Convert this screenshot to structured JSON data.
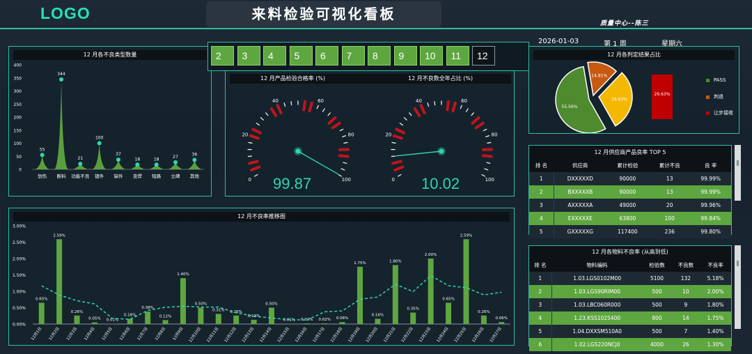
{
  "header": {
    "logo": "LOGO",
    "title": "来料检验可视化看板",
    "dept": "质量中心--陈三",
    "date": "2026-01-03",
    "week": "第 1 周",
    "weekday": "星期六"
  },
  "months": [
    "2",
    "3",
    "4",
    "5",
    "6",
    "7",
    "8",
    "9",
    "10",
    "11",
    "12"
  ],
  "selected_month": "12",
  "defect_types": {
    "title": "12 月各不良类型数量",
    "chart_data": {
      "type": "area",
      "categories": [
        "划伤",
        "断料",
        "功能不良",
        "镀件",
        "缺件",
        "变焊",
        "短路",
        "立碑",
        "其他"
      ],
      "values": [
        55,
        344,
        21,
        100,
        37,
        18,
        18,
        27,
        36
      ],
      "ylim": [
        0,
        400
      ],
      "yticks": [
        "0",
        "50",
        "100",
        "150",
        "200",
        "250",
        "300",
        "350",
        "400"
      ],
      "color": "#5ea640"
    }
  },
  "gauge_pass": {
    "title": "12 月产品检验合格率 (%)",
    "value": "99.87",
    "ticks": [
      "0",
      "20",
      "40",
      "60",
      "80",
      "100"
    ],
    "level": 99.87
  },
  "gauge_defect": {
    "title": "12 月不良数全年占比 (%)",
    "value": "10.02",
    "ticks": [
      "0",
      "20",
      "40",
      "60",
      "80",
      "100"
    ],
    "level": 10.02
  },
  "judgement": {
    "title": "12 月各判定结果占比",
    "chart_data": {
      "type": "pie",
      "slices": [
        {
          "name": "PASS",
          "value": 55.56,
          "label": "55.56%",
          "color": "#4e8a2e"
        },
        {
          "name": "判退",
          "value": 14.81,
          "label": "14.81%",
          "color": "#c65a12"
        },
        {
          "name": "",
          "value": 29.63,
          "label": "29.63%",
          "color": "#f5b800"
        }
      ],
      "bar": {
        "name": "让步接收",
        "value": 29.63,
        "label": "29.63%",
        "color": "#c00000"
      }
    }
  },
  "supplier_top5": {
    "title": "12 月供应商产品良率 TOP 5",
    "columns": [
      "排 名",
      "供应商",
      "累计检验",
      "累计不良",
      "良 率"
    ],
    "rows": [
      [
        "1",
        "DXXXXXD",
        "90000",
        "13",
        "99.99%"
      ],
      [
        "2",
        "BXXXXXB",
        "90000",
        "13",
        "99.99%"
      ],
      [
        "3",
        "AXXXXXA",
        "49000",
        "20",
        "99.96%"
      ],
      [
        "4",
        "EXXXXXE",
        "63800",
        "100",
        "99.84%"
      ],
      [
        "5",
        "GXXXXXG",
        "117400",
        "236",
        "99.80%"
      ]
    ]
  },
  "material_defect": {
    "title": "12 月各物料不良率 (从高到低)",
    "columns": [
      "排 名",
      "物料编码",
      "检验数",
      "不良数",
      "不良率"
    ],
    "rows": [
      [
        "1",
        "1.03.LGS0102M00",
        "5100",
        "132",
        "5.18%"
      ],
      [
        "2",
        "1.03.LGS90RIM00",
        "500",
        "10",
        "2.00%"
      ],
      [
        "3",
        "1.03.LBC060R000",
        "500",
        "9",
        "1.80%"
      ],
      [
        "4",
        "1.23.KSS1025400",
        "800",
        "14",
        "1.75%"
      ],
      [
        "5",
        "1.04.DXXSM510A0",
        "500",
        "7",
        "1.40%"
      ],
      [
        "6",
        "1.02.LGS220NCJ0",
        "4000",
        "26",
        "1.30%"
      ]
    ]
  },
  "trend": {
    "title": "12 月不良率推移图",
    "chart_data": {
      "type": "bar",
      "categories": [
        "12月1日",
        "12月2日",
        "12月3日",
        "12月4日",
        "12月5日",
        "12月6日",
        "12月7日",
        "12月8日",
        "12月9日",
        "12月10日",
        "12月11日",
        "12月12日",
        "12月13日",
        "12月14日",
        "12月15日",
        "12月16日",
        "12月17日",
        "12月18日",
        "12月19日",
        "12月20日",
        "12月21日",
        "12月22日",
        "12月23日",
        "12月24日",
        "12月25日",
        "12月26日",
        "12月27日"
      ],
      "values": [
        0.65,
        2.59,
        0.26,
        0.05,
        0.01,
        0.16,
        0.38,
        0.12,
        1.4,
        0.5,
        0.31,
        0.26,
        0.13,
        0.5,
        0.01,
        0.02,
        0.02,
        0.06,
        1.75,
        0.16,
        1.8,
        0.35,
        2.0,
        0.65,
        2.59,
        0.26,
        0.06
      ],
      "labels": [
        "0.65%",
        "2.59%",
        "0.26%",
        "0.05%",
        "0.01%",
        "0.16%",
        "0.38%",
        "0.12%",
        "1.40%",
        "0.50%",
        "0.31%",
        "0.26%",
        "0.13%",
        "0.50%",
        "0.01%",
        "0.02%",
        "0.02%",
        "0.06%",
        "1.75%",
        "0.16%",
        "1.80%",
        "0.35%",
        "2.00%",
        "0.65%",
        "2.59%",
        "0.26%",
        "0.06%"
      ],
      "yticks": [
        "0.00%",
        "0.50%",
        "1.00%",
        "1.50%",
        "2.00%",
        "2.50%",
        "3.00%"
      ],
      "ylim": [
        0,
        3.0
      ],
      "trend_line": true
    }
  }
}
